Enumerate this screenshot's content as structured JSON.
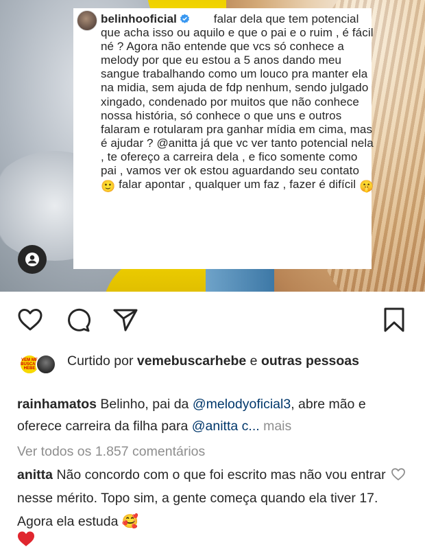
{
  "post": {
    "caption": {
      "username": "belinhooficial",
      "verified": true,
      "text": "falar dela que tem potencial que acha isso ou aquilo e que o pai e o ruim , é fácil né ? Agora não entende que vcs só conhece a melody por que eu estou a 5 anos dando meu sangue trabalhando como um louco pra manter ela na midia, sem ajuda de fdp nenhum, sendo julgado xingado, condenado por muitos que não conhece nossa história, só conhece o que uns e outros falaram e rotularam pra ganhar mídia em cima, mas é ajudar ?",
      "mention": "@anitta",
      "text_after_mention": "já que vc ver tanto potencial nela , te ofereço a carreira dela , e fico somente como pai , vamos ver ok estou aguardando seu contato",
      "text_after_emoji": "falar apontar , qualquer um faz , fazer é difícil",
      "emoji_smile": "🙂",
      "emoji_hush": "🤫"
    },
    "tag_icon": "user-tag-icon"
  },
  "actions": {
    "like_icon": "heart-icon",
    "comment_icon": "comment-icon",
    "share_icon": "send-icon",
    "save_icon": "bookmark-icon"
  },
  "likes": {
    "prefix": "Curtido por",
    "user": "vemebuscarhebe",
    "connector": "e",
    "others": "outras pessoas",
    "avatar1_text": "VEM ME BUSCAR HEBE"
  },
  "comments": [
    {
      "username": "rainhamatos",
      "text_before": "Belinho, pai da",
      "mention1": "@melodyoficial3",
      "text_middle": ", abre mão e oferece carreira da filha para",
      "mention2": "@anitta c...",
      "more": "mais"
    },
    {
      "username": "anitta",
      "text": "Não concordo com o que foi escrito mas não vou entrar nesse mérito. Topo sim, a gente começa quando ela tiver 17. Agora ela estuda",
      "emoji": "🥰"
    }
  ],
  "view_all": "Ver todos os 1.857 comentários",
  "colors": {
    "text": "#262626",
    "muted": "#8e8e8e",
    "mention": "#00376b",
    "verified": "#3897f0",
    "heart_red": "#ed4956"
  }
}
